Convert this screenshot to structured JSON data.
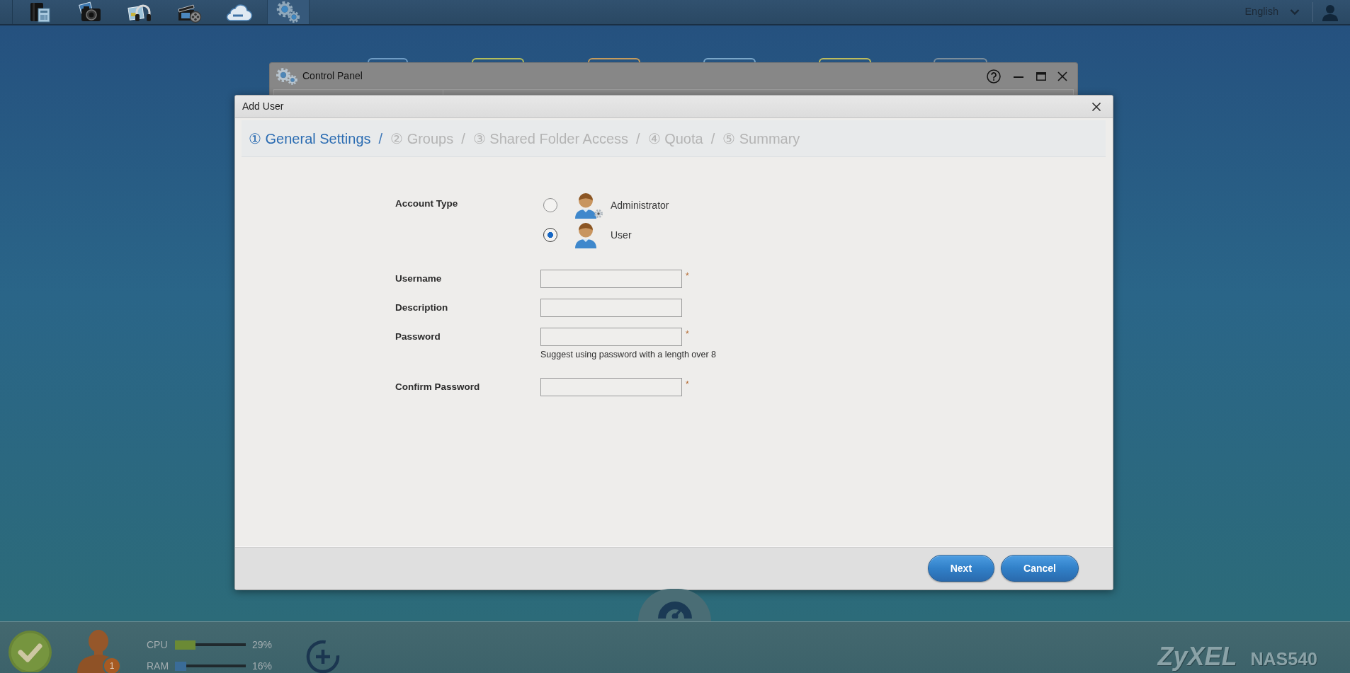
{
  "top_bar": {
    "apps": [
      {
        "kind": "files",
        "selected": false
      },
      {
        "kind": "photo",
        "selected": false
      },
      {
        "kind": "music",
        "selected": false
      },
      {
        "kind": "video",
        "selected": false
      },
      {
        "kind": "cloud",
        "selected": false
      },
      {
        "kind": "settings",
        "selected": true
      }
    ],
    "language": "English"
  },
  "background_window": {
    "title": "Control Panel"
  },
  "dialog": {
    "title": "Add User",
    "steps": [
      {
        "label": "① General Settings",
        "selected": true,
        "separator": "/"
      },
      {
        "label": "② Groups",
        "selected": false,
        "separator": "/"
      },
      {
        "label": "③ Shared Folder Access",
        "selected": false,
        "separator": "/"
      },
      {
        "label": "④ Quota",
        "selected": false,
        "separator": "/"
      },
      {
        "label": "⑤ Summary",
        "selected": false
      }
    ],
    "account_type": {
      "label": "Account Type",
      "options": [
        {
          "kind": "admin",
          "label": "Administrator",
          "selected": false
        },
        {
          "kind": "user",
          "label": "User",
          "selected": true
        }
      ]
    },
    "fields": [
      {
        "label": "Username",
        "required_mark": "*"
      },
      {
        "label": "Description"
      },
      {
        "label": "Password",
        "required_mark": "*",
        "hint": "Suggest using password with a length over 8"
      },
      {
        "label": "Confirm Password",
        "required_mark": "*"
      }
    ],
    "buttons": [
      "Next",
      "Cancel"
    ]
  },
  "status_bar": {
    "user_count": "1",
    "meters": [
      {
        "label": "CPU",
        "level": 0.29,
        "reading": "29%",
        "color": "#6b8a35"
      },
      {
        "label": "RAM",
        "level": 0.16,
        "reading": "16%",
        "color": "#3a6c98"
      }
    ],
    "brand": "ZyXEL",
    "model": "NAS540"
  }
}
